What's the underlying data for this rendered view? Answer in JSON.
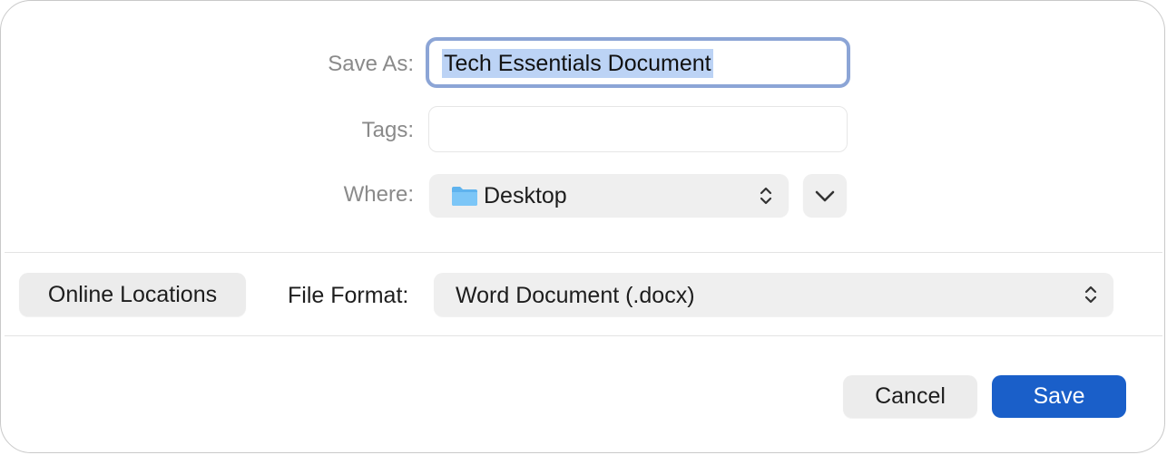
{
  "dialog": {
    "save_as_label": "Save As:",
    "save_as_value": "Tech Essentials Document",
    "tags_label": "Tags:",
    "tags_value": "",
    "where_label": "Where:",
    "where_value": "Desktop",
    "where_icon": "folder-icon",
    "expand_icon": "chevron-down-icon"
  },
  "options": {
    "online_locations_label": "Online Locations",
    "file_format_label": "File Format:",
    "file_format_value": "Word Document (.docx)"
  },
  "actions": {
    "cancel_label": "Cancel",
    "save_label": "Save"
  },
  "colors": {
    "accent": "#1a5fc9",
    "focus_ring": "#8ca5d6",
    "selection": "#bcd3f5"
  }
}
